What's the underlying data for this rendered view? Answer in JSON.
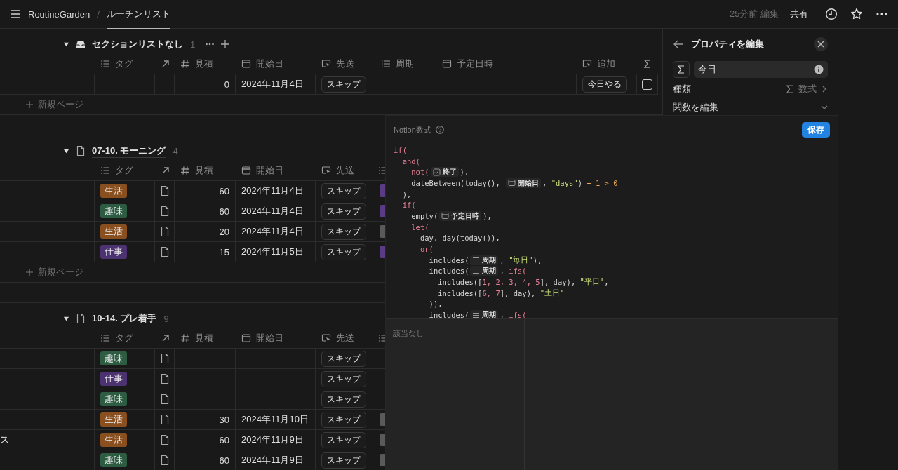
{
  "topbar": {
    "workspace": "RoutineGarden",
    "separator": "/",
    "page": "ルーチンリスト",
    "edited": "25分前 編集",
    "share": "共有"
  },
  "groups": [
    {
      "kind": "no_section",
      "title": "セクションリストなし",
      "count": "1",
      "actions": true,
      "columns": [
        {
          "kind": "multi_select",
          "label": "タグ"
        },
        {
          "kind": "relation"
        },
        {
          "kind": "number",
          "label": "見積"
        },
        {
          "kind": "date",
          "label": "開始日"
        },
        {
          "kind": "button",
          "label": "先送"
        },
        {
          "kind": "multi_select",
          "label": "周期"
        },
        {
          "kind": "date",
          "label": "予定日時"
        },
        {
          "kind": "button",
          "label": "追加"
        },
        {
          "kind": "formula"
        }
      ],
      "rows": [
        {
          "relation": false,
          "estimate": "0",
          "start_date": "2024年11月4日",
          "defer": "スキップ",
          "add": "今日やる",
          "done": false
        }
      ],
      "new_page": "新規ページ"
    },
    {
      "kind": "page",
      "title": "07-10. モーニング",
      "count": "4",
      "actions": false,
      "columns": [
        {
          "kind": "multi_select",
          "label": "タグ"
        },
        {
          "kind": "relation"
        },
        {
          "kind": "number",
          "label": "見積"
        },
        {
          "kind": "date",
          "label": "開始日"
        },
        {
          "kind": "button",
          "label": "先送"
        },
        {
          "kind": "multi_select"
        }
      ],
      "rows": [
        {
          "tag": {
            "label": "生活",
            "color": "#8a4f1f"
          },
          "relation": true,
          "estimate": "60",
          "start_date": "2024年11月4日",
          "defer": "スキップ",
          "period_tag": {
            "color": "#5b3a86"
          }
        },
        {
          "tag": {
            "label": "趣味",
            "color": "#2d5c43"
          },
          "relation": true,
          "estimate": "60",
          "start_date": "2024年11月4日",
          "defer": "スキップ",
          "period_tag": {
            "color": "#5b3a86"
          }
        },
        {
          "tag": {
            "label": "生活",
            "color": "#8a4f1f"
          },
          "relation": true,
          "estimate": "20",
          "start_date": "2024年11月4日",
          "defer": "スキップ",
          "period_tag": {
            "color": "#5a5a5a"
          }
        },
        {
          "tag": {
            "label": "仕事",
            "color": "#4c3270"
          },
          "relation": true,
          "estimate": "15",
          "start_date": "2024年11月5日",
          "defer": "スキップ",
          "period_tag": {
            "color": "#5b3a86"
          }
        }
      ],
      "new_page": "新規ページ"
    },
    {
      "kind": "page",
      "title": "10-14. プレ着手",
      "count": "9",
      "actions": false,
      "columns": [
        {
          "kind": "multi_select",
          "label": "タグ"
        },
        {
          "kind": "relation"
        },
        {
          "kind": "number",
          "label": "見積"
        },
        {
          "kind": "date",
          "label": "開始日"
        },
        {
          "kind": "button",
          "label": "先送"
        },
        {
          "kind": "multi_select"
        }
      ],
      "rows": [
        {
          "tag": {
            "label": "趣味",
            "color": "#2d5c43"
          },
          "relation": true,
          "defer": "スキップ"
        },
        {
          "tag": {
            "label": "仕事",
            "color": "#4c3270"
          },
          "relation": true,
          "defer": "スキップ"
        },
        {
          "tag": {
            "label": "趣味",
            "color": "#2d5c43"
          },
          "relation": true,
          "defer": "スキップ"
        },
        {
          "tag": {
            "label": "生活",
            "color": "#8a4f1f"
          },
          "relation": true,
          "estimate": "30",
          "start_date": "2024年11月10日",
          "defer": "スキップ",
          "period_tag": {
            "color": "#5a5a5a"
          }
        },
        {
          "title": "ス",
          "tag": {
            "label": "生活",
            "color": "#8a4f1f"
          },
          "relation": true,
          "estimate": "60",
          "start_date": "2024年11月9日",
          "defer": "スキップ",
          "period_tag": {
            "color": "#5a5a5a"
          }
        },
        {
          "tag": {
            "label": "趣味",
            "color": "#2d5c43"
          },
          "relation": true,
          "estimate": "60",
          "start_date": "2024年11月9日",
          "defer": "スキップ",
          "period_tag": {
            "color": "#5a5a5a"
          }
        }
      ]
    }
  ],
  "property_panel": {
    "title": "プロパティを編集",
    "name_value": "今日",
    "type_label": "種類",
    "type_value": "数式",
    "function_label": "関数を編集"
  },
  "formula_editor": {
    "title": "Notion数式",
    "save": "保存",
    "empty_result": "該当なし",
    "lines": [
      [
        {
          "kind": "kw",
          "text": "if("
        }
      ],
      [
        {
          "kind": "kw",
          "text": "  and("
        }
      ],
      [
        {
          "kind": "kw",
          "text": "    not("
        },
        {
          "kind": "prop_checkbox",
          "text": "終了"
        },
        {
          "kind": "plain",
          "text": "),"
        }
      ],
      [
        {
          "kind": "plain",
          "text": "    dateBetween(today(), "
        },
        {
          "kind": "prop_date",
          "text": "開始日"
        },
        {
          "kind": "plain",
          "text": ", "
        },
        {
          "kind": "str",
          "text": "\"days\""
        },
        {
          "kind": "plain",
          "text": ") "
        },
        {
          "kind": "op",
          "text": "+ 1 > 0"
        }
      ],
      [
        {
          "kind": "plain",
          "text": "  ),"
        }
      ],
      [
        {
          "kind": "kw",
          "text": "  if("
        }
      ],
      [
        {
          "kind": "plain",
          "text": "    empty("
        },
        {
          "kind": "prop_date",
          "text": "予定日時"
        },
        {
          "kind": "plain",
          "text": "),"
        }
      ],
      [
        {
          "kind": "kw",
          "text": "    let("
        }
      ],
      [
        {
          "kind": "plain",
          "text": "      day, day(today()),"
        }
      ],
      [
        {
          "kind": "kw",
          "text": "      or("
        }
      ],
      [
        {
          "kind": "plain",
          "text": "        includes("
        },
        {
          "kind": "prop_list",
          "text": "周期"
        },
        {
          "kind": "plain",
          "text": ", "
        },
        {
          "kind": "str",
          "text": "\"毎日\""
        },
        {
          "kind": "plain",
          "text": "),"
        }
      ],
      [
        {
          "kind": "plain",
          "text": "        includes("
        },
        {
          "kind": "prop_list",
          "text": "周期"
        },
        {
          "kind": "plain",
          "text": ", "
        },
        {
          "kind": "kw",
          "text": "ifs("
        }
      ],
      [
        {
          "kind": "plain",
          "text": "          includes(["
        },
        {
          "kind": "num",
          "text": "1, 2, 3, 4, 5"
        },
        {
          "kind": "plain",
          "text": "], day), "
        },
        {
          "kind": "str",
          "text": "\"平日\""
        },
        {
          "kind": "plain",
          "text": ","
        }
      ],
      [
        {
          "kind": "plain",
          "text": "          includes(["
        },
        {
          "kind": "num",
          "text": "6, 7"
        },
        {
          "kind": "plain",
          "text": "], day), "
        },
        {
          "kind": "str",
          "text": "\"土日\""
        }
      ],
      [
        {
          "kind": "plain",
          "text": "        )),"
        }
      ],
      [
        {
          "kind": "plain",
          "text": "        includes("
        },
        {
          "kind": "prop_list",
          "text": "周期"
        },
        {
          "kind": "plain",
          "text": ", "
        },
        {
          "kind": "kw",
          "text": "ifs("
        }
      ]
    ]
  }
}
